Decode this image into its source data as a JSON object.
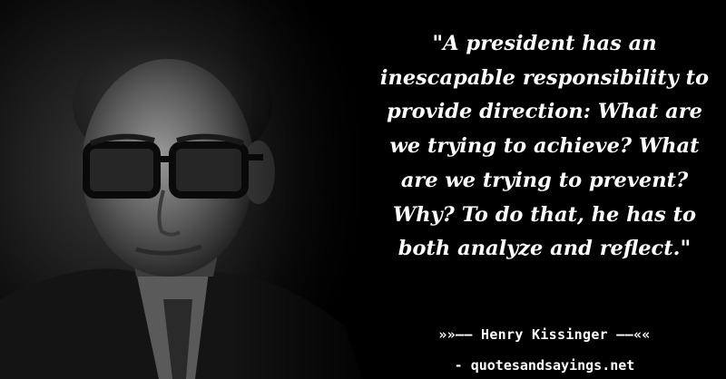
{
  "quote": {
    "text": "\"A president has an\ninescapable responsibility to\nprovide direction: What are\nwe trying to achieve? What\nare we trying to prevent?\nWhy? To do that, he has to\nboth analyze and reflect.\""
  },
  "attribution": {
    "text": "»»—— Henry Kissinger ——««"
  },
  "site": {
    "text": "- quotesandsayings.net"
  },
  "colors": {
    "background": "#000000",
    "text": "#ffffff"
  }
}
